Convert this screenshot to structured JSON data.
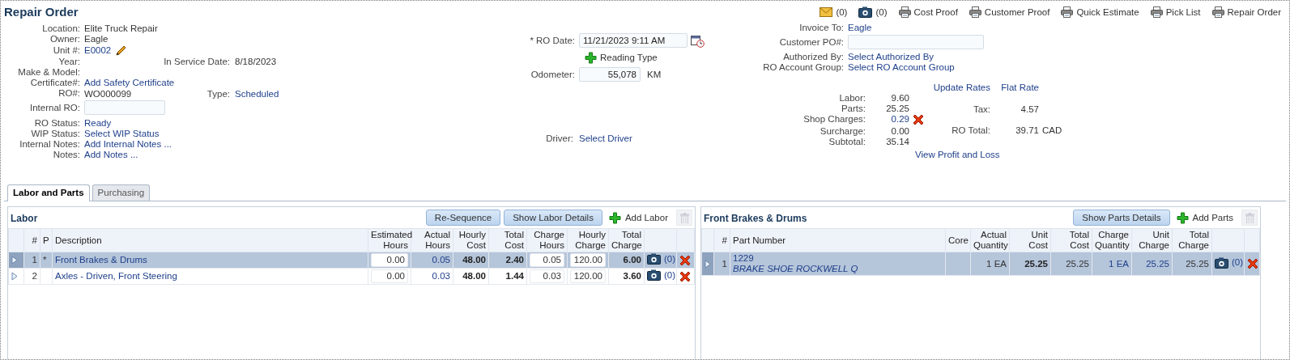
{
  "title": "Repair Order",
  "toolbar": [
    {
      "kind": "mail",
      "label": "(0)"
    },
    {
      "kind": "camera",
      "label": "(0)"
    },
    {
      "kind": "print",
      "label": "Cost Proof"
    },
    {
      "kind": "print",
      "label": "Customer Proof"
    },
    {
      "kind": "print",
      "label": "Quick Estimate"
    },
    {
      "kind": "print",
      "label": "Pick List"
    },
    {
      "kind": "print",
      "label": "Repair Order"
    }
  ],
  "unit_fields": [
    {
      "label": "Location:",
      "kind": "text",
      "value": "Elite Truck Repair"
    },
    {
      "label": "Owner:",
      "kind": "text",
      "value": "Eagle"
    },
    {
      "label": "Unit #:",
      "kind": "link",
      "value": "E0002",
      "editable": true
    },
    {
      "label": "Year:",
      "kind": "none",
      "extra": {
        "label": "In Service Date:",
        "kind": "text",
        "value": "8/18/2023"
      }
    },
    {
      "label": "Make & Model:",
      "kind": "none"
    },
    {
      "label": "Certificate#:",
      "kind": "link",
      "value": "Add Safety Certificate"
    },
    {
      "label": "RO#:",
      "kind": "text",
      "value": "WO000099",
      "extra": {
        "label": "Type:",
        "kind": "link",
        "value": "Scheduled"
      }
    },
    {
      "label": "Internal RO:",
      "kind": "input"
    },
    {
      "label": "RO Status:",
      "kind": "link",
      "value": "Ready"
    },
    {
      "label": "WIP Status:",
      "kind": "link",
      "value": "Select WIP Status"
    },
    {
      "label": "Internal Notes:",
      "kind": "link",
      "value": "Add Internal Notes ..."
    },
    {
      "label": "Notes:",
      "kind": "link",
      "value": "Add Notes ..."
    }
  ],
  "ro_date": {
    "label": "* RO Date:",
    "value": "11/21/2023 9:11 AM"
  },
  "reading_type": "Reading Type",
  "odometer": {
    "label": "Odometer:",
    "value": "55,078",
    "unit": "KM"
  },
  "driver": {
    "label": "Driver:",
    "value": "Select Driver"
  },
  "billing_fields": [
    {
      "label": "Invoice To:",
      "kind": "link",
      "value": "Eagle"
    },
    {
      "label": "Customer PO#:",
      "kind": "input"
    },
    {
      "label": "Authorized By:",
      "kind": "link",
      "value": "Select Authorized By"
    },
    {
      "label": "RO Account Group:",
      "kind": "link",
      "value": "Select RO Account Group"
    }
  ],
  "totals": [
    {
      "label": "Labor:",
      "value": "9.60",
      "kind": "text"
    },
    {
      "label": "Parts:",
      "value": "25.25",
      "kind": "text"
    },
    {
      "label": "Shop Charges:",
      "value": "0.29",
      "kind": "link",
      "removable": true
    },
    {
      "label": "Surcharge:",
      "value": "0.00",
      "kind": "text"
    },
    {
      "label": "Subtotal:",
      "value": "35.14",
      "kind": "text"
    }
  ],
  "rate_links": [
    "Update Rates",
    "Flat Rate"
  ],
  "grand_totals": [
    {
      "label": "Tax:",
      "value": "4.57"
    },
    {
      "label": "RO Total:",
      "value": "39.71",
      "currency": "CAD"
    }
  ],
  "profit_link": "View Profit and Loss",
  "tabs": [
    {
      "label": "Labor and Parts",
      "selected": true
    },
    {
      "label": "Purchasing",
      "selected": false
    }
  ],
  "labor": {
    "title": "Labor",
    "buttons": [
      "Re-Sequence",
      "Show Labor Details"
    ],
    "add": "Add Labor",
    "delete_disabled": true,
    "columns": [
      "#",
      "P",
      "Description",
      "Estimated Hours",
      "Actual Hours",
      "Hourly Cost",
      "Total Cost",
      "Charge Hours",
      "Hourly Charge",
      "Total Charge"
    ],
    "rows": [
      {
        "selected": true,
        "number": "1",
        "priority": "*",
        "description": "Front Brakes & Drums",
        "estimated_hours": "0.00",
        "actual_hours": "0.05",
        "hourly_cost": "48.00",
        "total_cost": "2.40",
        "charge_hours": "0.05",
        "hourly_charge": "120.00",
        "total_charge": "6.00",
        "photos": "(0)"
      },
      {
        "selected": false,
        "number": "2",
        "description": "Axles - Driven, Front Steering",
        "estimated_hours": "0.00",
        "actual_hours": "0.03",
        "hourly_cost": "48.00",
        "total_cost": "1.44",
        "charge_hours": "0.03",
        "hourly_charge": "120.00",
        "total_charge": "3.60",
        "photos": "(0)"
      }
    ]
  },
  "parts": {
    "title": "Front Brakes & Drums",
    "buttons": [
      "Show Parts Details"
    ],
    "add": "Add Parts",
    "delete_disabled": true,
    "columns": [
      "#",
      "Part Number",
      "Core",
      "Actual Quantity",
      "Unit Cost",
      "Total Cost",
      "Charge Quantity",
      "Unit Charge",
      "Total Charge"
    ],
    "rows": [
      {
        "selected": true,
        "number": "1",
        "part_number": "1229",
        "description": "BRAKE SHOE ROCKWELL Q",
        "actual_quantity": "1 EA",
        "unit_cost": "25.25",
        "total_cost": "25.25",
        "charge_quantity": "1 EA",
        "unit_charge": "25.25",
        "total_charge": "25.25",
        "photos": "(0)"
      }
    ]
  }
}
